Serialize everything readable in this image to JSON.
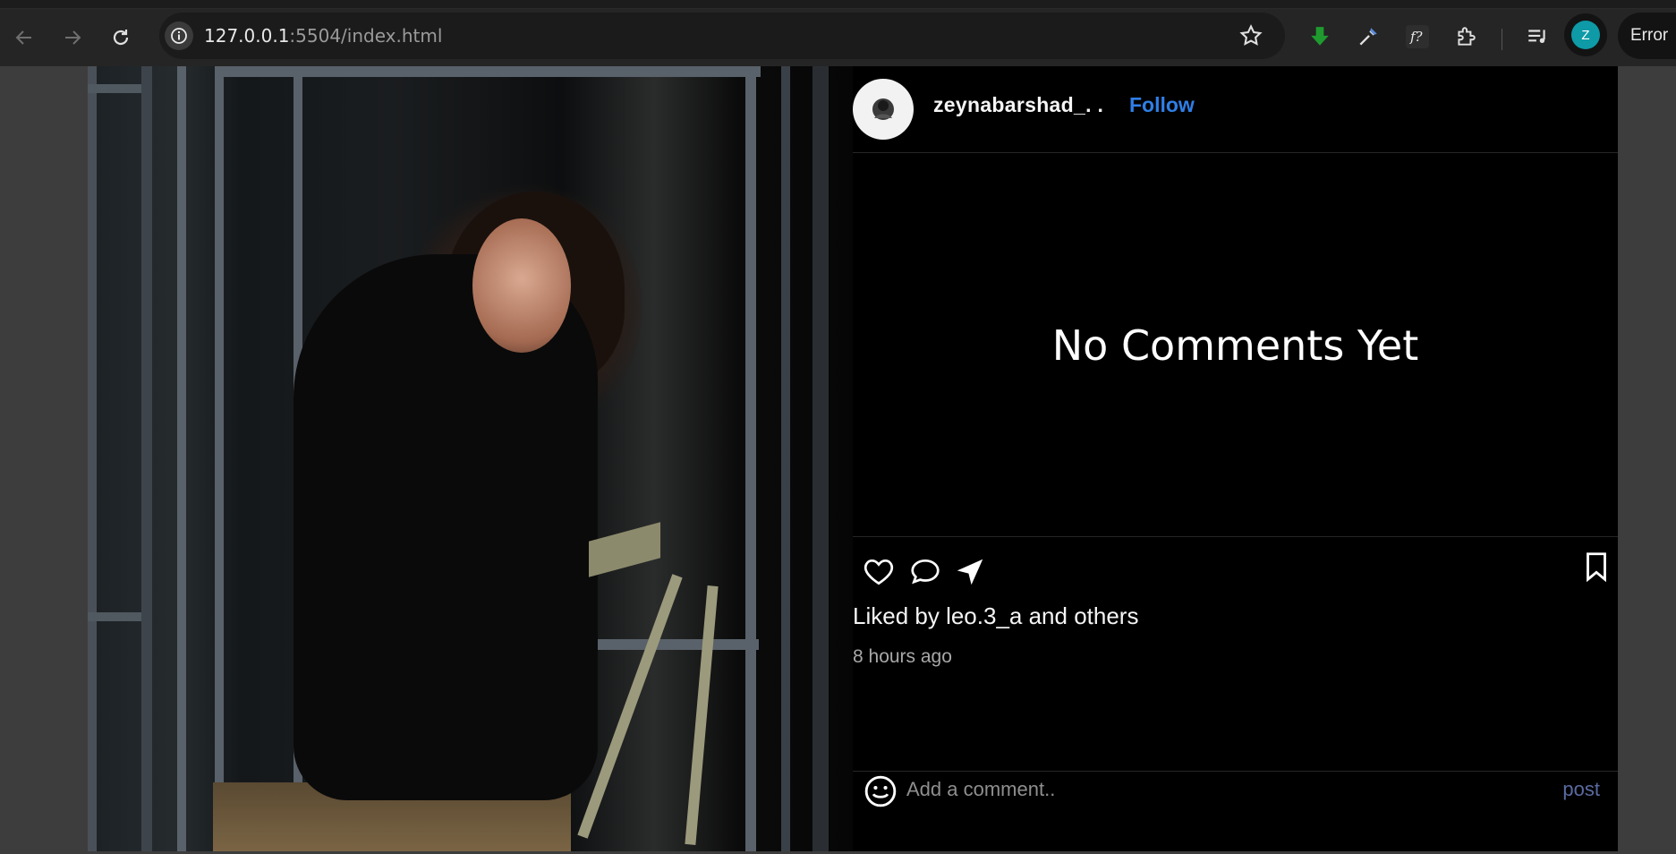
{
  "browser": {
    "url_host": "127.0.0.1",
    "url_rest": ":5504/index.html",
    "profile_initial": "Z",
    "error_label": "Error",
    "icons": [
      "back-icon",
      "forward-icon",
      "reload-icon",
      "info-icon",
      "bookmark-star-icon",
      "download-icon",
      "eyedropper-icon",
      "font-identifier-icon",
      "extensions-icon",
      "reading-list-icon"
    ]
  },
  "post": {
    "username": "zeynabarshad_. .",
    "follow_label": "Follow",
    "empty_comments": "No Comments Yet",
    "liked_by": "Liked by leo.3_a and others",
    "timestamp": "8 hours ago",
    "comment_placeholder": "Add a comment..",
    "post_label": "post",
    "icons": [
      "heart-icon",
      "comment-icon",
      "share-icon",
      "bookmark-icon",
      "emoji-icon"
    ],
    "colors": {
      "follow": "#2f7fe6",
      "post_button": "#5a6aa0",
      "background": "#000000"
    }
  }
}
